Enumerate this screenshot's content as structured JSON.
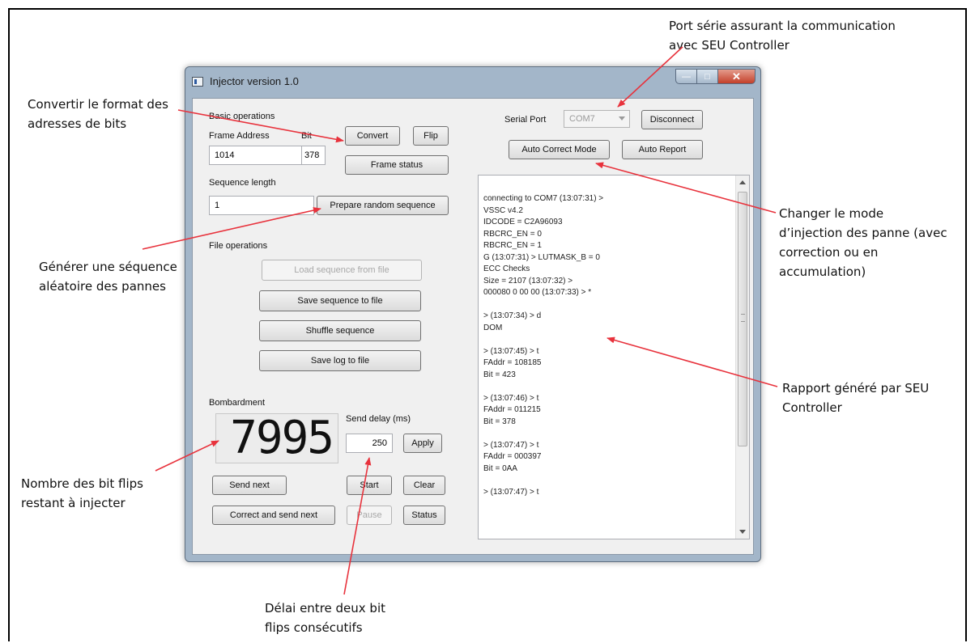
{
  "annotations": {
    "serial_port_line1": "Port série assurant la communication",
    "serial_port_line2": "avec SEU Controller",
    "convert_line1": "Convertir le format des",
    "convert_line2": "adresses de bits",
    "sequence_line1": "Générer une séquence",
    "sequence_line2": "aléatoire des pannes",
    "mode_line1": "Changer le mode",
    "mode_line2": "d’injection des panne (avec",
    "mode_line3": "correction ou en",
    "mode_line4": "accumulation)",
    "report_line1": "Rapport généré par SEU",
    "report_line2": "Controller",
    "bitflips_line1": "Nombre des bit flips",
    "bitflips_line2": "restant à injecter",
    "delay_line1": "Délai entre deux bit",
    "delay_line2": "flips consécutifs"
  },
  "window": {
    "title": "Injector version 1.0",
    "min_glyph": "—",
    "max_glyph": "□",
    "close_glyph": "✕"
  },
  "basic": {
    "section_label": "Basic operations",
    "frame_address_label": "Frame Address",
    "bit_label": "Bit",
    "frame_address_value": "1014",
    "bit_value": "378",
    "convert_label": "Convert",
    "flip_label": "Flip",
    "frame_status_label": "Frame status",
    "sequence_length_label": "Sequence length",
    "sequence_length_value": "1",
    "prepare_label": "Prepare random sequence"
  },
  "file": {
    "section_label": "File operations",
    "load_label": "Load sequence from file",
    "save_sequence_label": "Save sequence to file",
    "shuffle_label": "Shuffle sequence",
    "save_log_label": "Save log to file"
  },
  "bombardment": {
    "section_label": "Bombardment",
    "counter": "7995",
    "send_delay_label": "Send delay (ms)",
    "send_delay_value": "250",
    "apply_label": "Apply",
    "send_next_label": "Send next",
    "start_label": "Start",
    "clear_label": "Clear",
    "correct_send_label": "Correct and send next",
    "pause_label": "Pause",
    "status_label": "Status"
  },
  "serial": {
    "port_label": "Serial Port",
    "port_value": "COM7",
    "disconnect_label": "Disconnect",
    "auto_correct_label": "Auto Correct Mode",
    "auto_report_label": "Auto Report"
  },
  "log": {
    "text": "connecting to COM7 (13:07:31) >\nVSSC v4.2\nIDCODE = C2A96093\nRBCRC_EN = 0\nRBCRC_EN = 1\nG (13:07:31) > LUTMASK_B = 0\nECC Checks\nSize = 2107 (13:07:32) >\n000080 0 00 00 (13:07:33) > *\n\n> (13:07:34) > d\nDOM\n\n> (13:07:45) > t\nFAddr = 108185\nBit = 423\n\n> (13:07:46) > t\nFAddr = 011215\nBit = 378\n\n> (13:07:47) > t\nFAddr = 000397\nBit = 0AA\n\n> (13:07:47) > t"
  }
}
